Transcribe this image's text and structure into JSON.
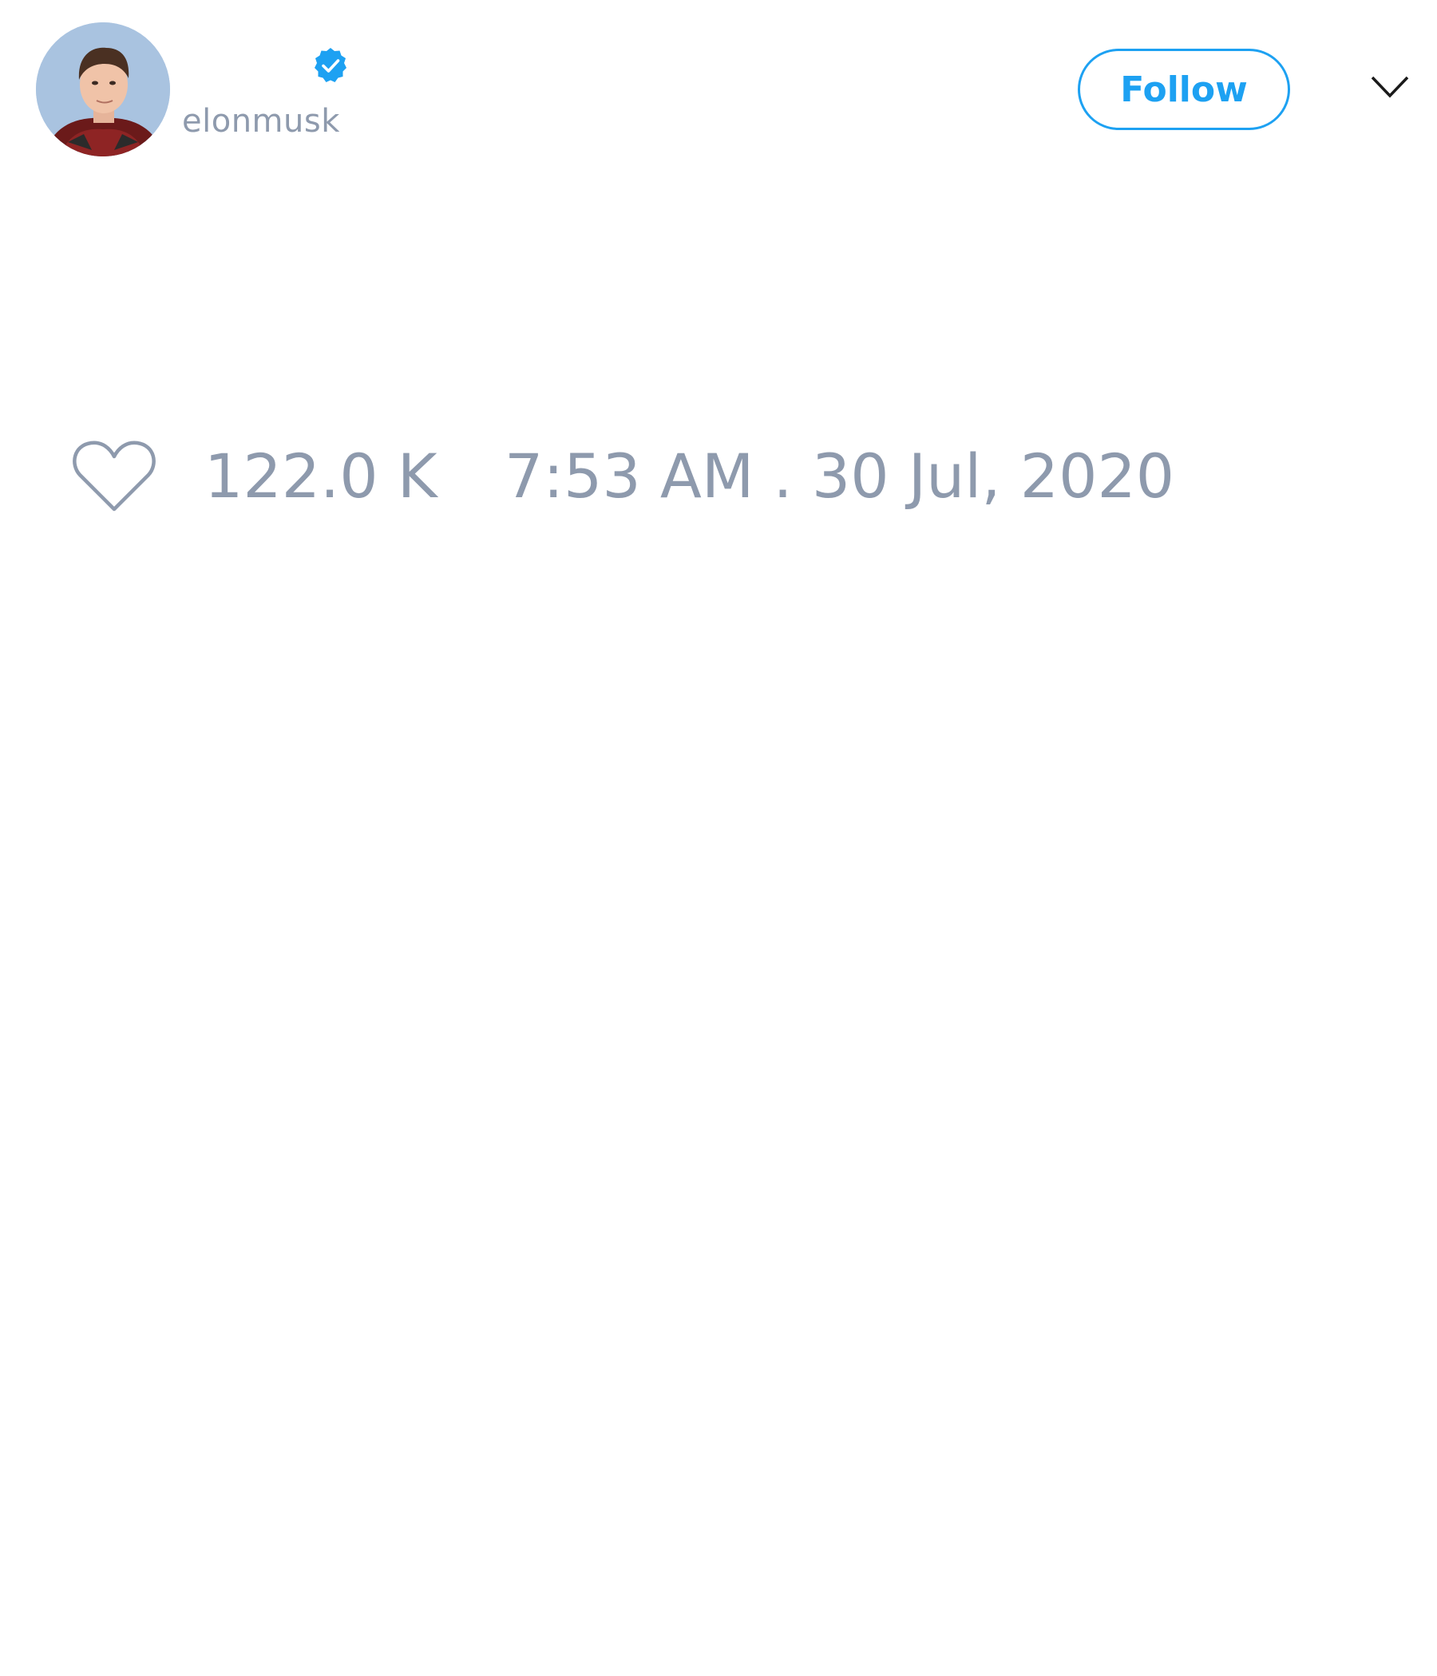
{
  "user": {
    "handle": "elonmusk",
    "verified": true,
    "avatar": "profile-photo"
  },
  "header": {
    "follow_label": "Follow",
    "menu_icon": "chevron-down-icon"
  },
  "stats": {
    "like_icon": "heart-outline-icon",
    "likes": "122.0 K",
    "timestamp": "7:53 AM . 30 Jul, 2020"
  },
  "colors": {
    "accent": "#1da1f2",
    "muted_text": "#8e9aad",
    "background": "#ffffff"
  }
}
